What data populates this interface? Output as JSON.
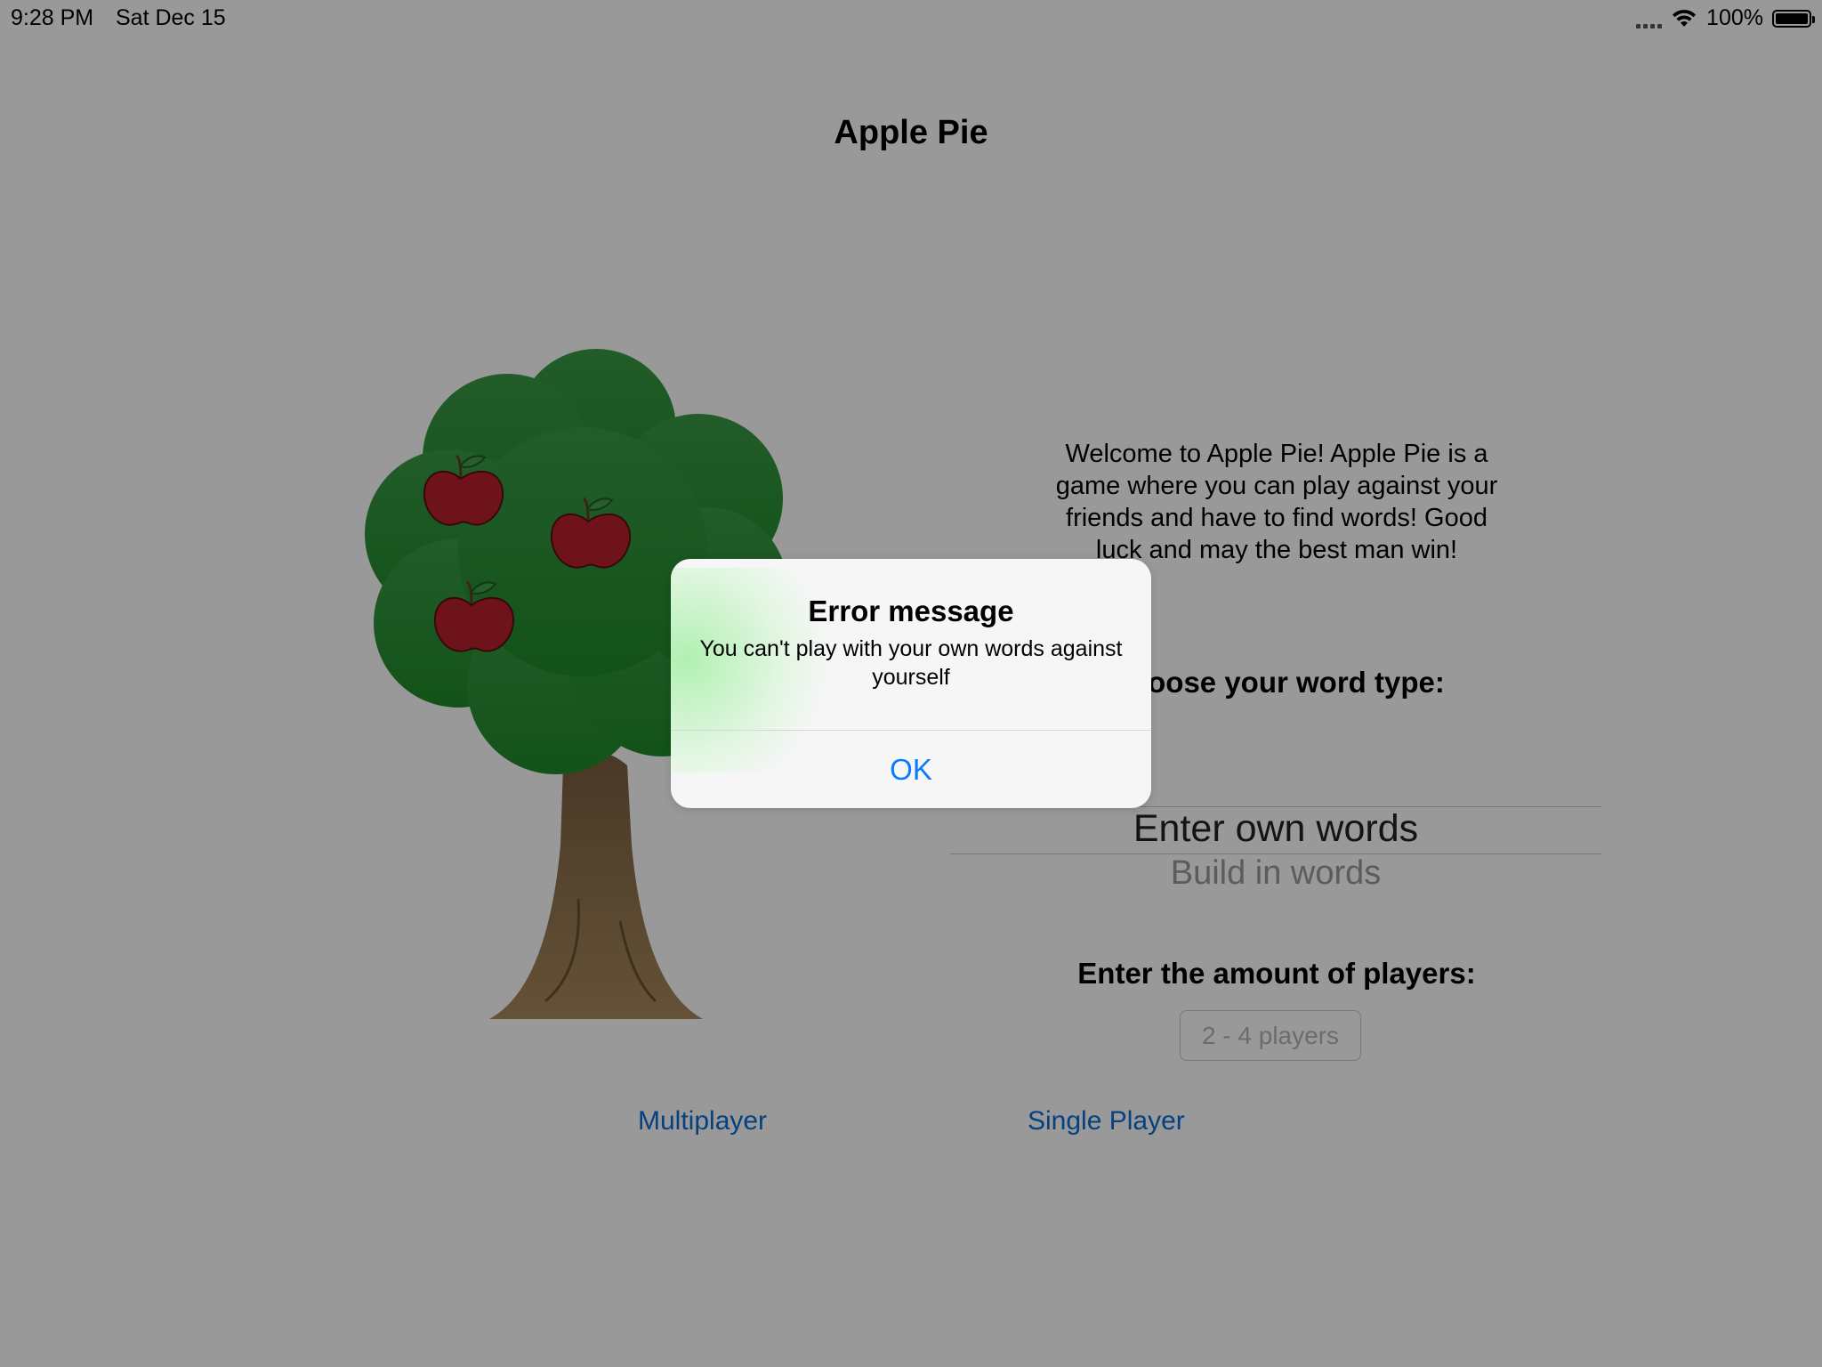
{
  "status_bar": {
    "time": "9:28 PM",
    "date": "Sat Dec 15",
    "battery": "100%",
    "icons": [
      "signal-dots-icon",
      "wifi-icon",
      "battery-icon"
    ]
  },
  "app": {
    "title": "Apple Pie",
    "welcome": "Welcome to Apple Pie! Apple Pie is a game where you can play against your friends and have to find words! Good luck and may the best man win!",
    "word_type_label": "Choose your word type:",
    "picker": {
      "selected": "Enter own words",
      "options": [
        "Enter own words",
        "Build in words"
      ],
      "next_option": "Build in words"
    },
    "players_label": "Enter the amount of players:",
    "players_placeholder": "2 - 4 players",
    "multiplayer_button": "Multiplayer",
    "single_player_button": "Single Player"
  },
  "alert": {
    "title": "Error message",
    "message": "You can't play with your own words against yourself",
    "ok_label": "OK"
  },
  "colors": {
    "link": "#0a6cd8",
    "alert_button": "#0a7aff",
    "tree_leaves": "#2a8a36",
    "tree_trunk": "#6b5437",
    "apple": "#b8202c"
  }
}
